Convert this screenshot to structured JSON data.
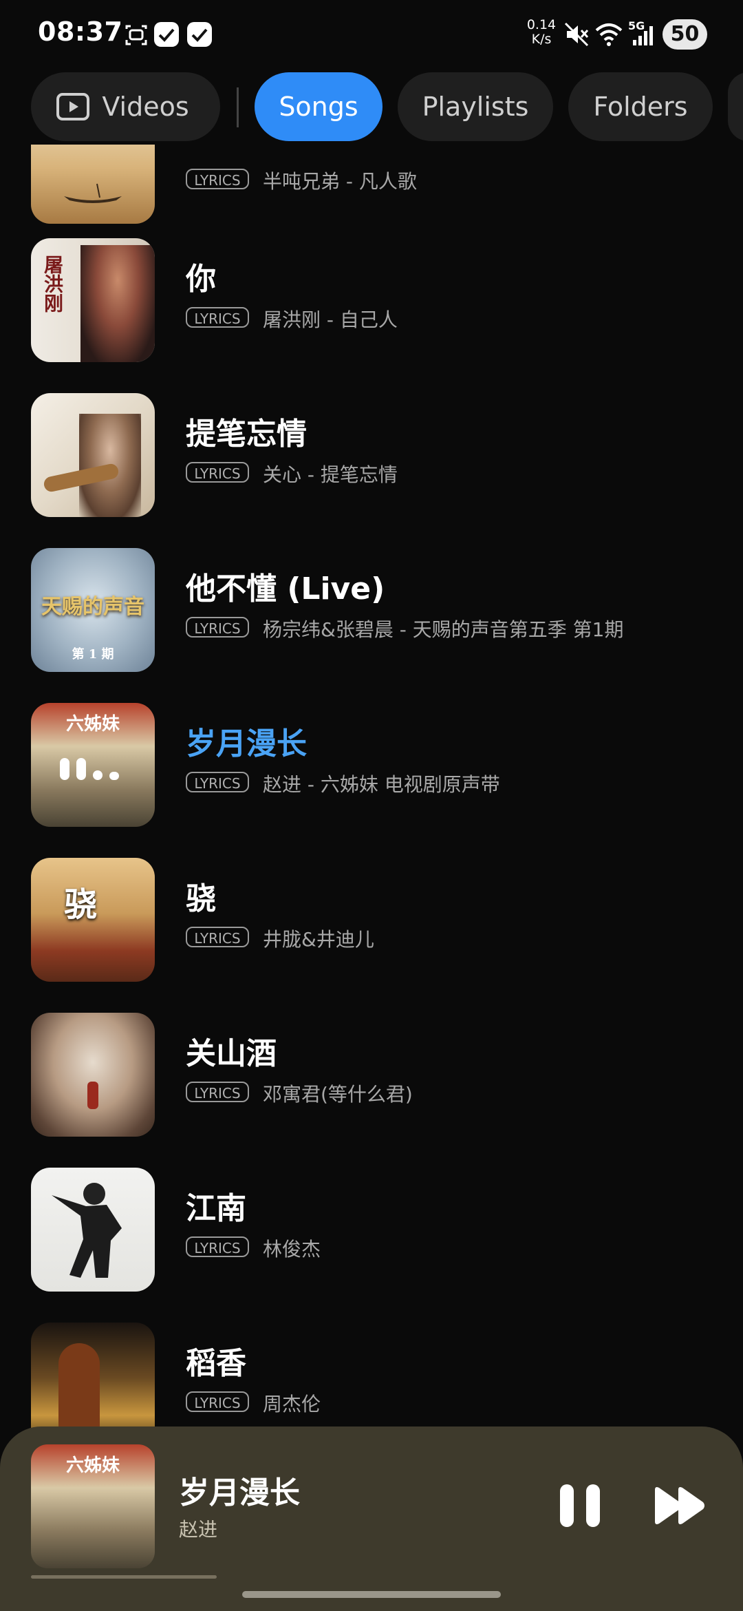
{
  "status_bar": {
    "time": "08:37",
    "net_speed_value": "0.14",
    "net_speed_unit": "K/s",
    "network": "5G",
    "battery": "50"
  },
  "tabs": [
    {
      "label": "Videos",
      "icon": "video-icon",
      "active": false
    },
    {
      "label": "Songs",
      "active": true
    },
    {
      "label": "Playlists",
      "active": false
    },
    {
      "label": "Folders",
      "active": false
    }
  ],
  "lyrics_badge": "LYRICS",
  "songs": [
    {
      "title": "",
      "artist": "半吨兄弟 - 凡人歌",
      "lyrics": true
    },
    {
      "title": "你",
      "artist": "屠洪刚 - 自己人",
      "lyrics": true
    },
    {
      "title": "提笔忘情",
      "artist": "关心 - 提笔忘情",
      "lyrics": true
    },
    {
      "title": "他不懂 (Live)",
      "artist": "杨宗纬&张碧晨 - 天赐的声音第五季 第1期",
      "lyrics": true
    },
    {
      "title": "岁月漫长",
      "artist": "赵进 - 六姊妹 电视剧原声带",
      "lyrics": true,
      "playing": true
    },
    {
      "title": "骁",
      "artist": "井胧&井迪儿",
      "lyrics": true
    },
    {
      "title": "关山酒",
      "artist": "邓寓君(等什么君)",
      "lyrics": true
    },
    {
      "title": "江南",
      "artist": "林俊杰",
      "lyrics": true
    },
    {
      "title": "稻香",
      "artist": "周杰伦",
      "lyrics": true
    }
  ],
  "covers": {
    "c1": "屠洪刚",
    "c3": "天赐的声音",
    "c3b": "第 1 期",
    "c4": "六姊妹",
    "c5": "骁"
  },
  "now_playing": {
    "title": "岁月漫长",
    "artist": "赵进",
    "progress": 0.25
  },
  "colors": {
    "accent": "#2f8cf7",
    "playing_title": "#4aa3f5",
    "mini_player_bg": "#3e3a2c"
  }
}
